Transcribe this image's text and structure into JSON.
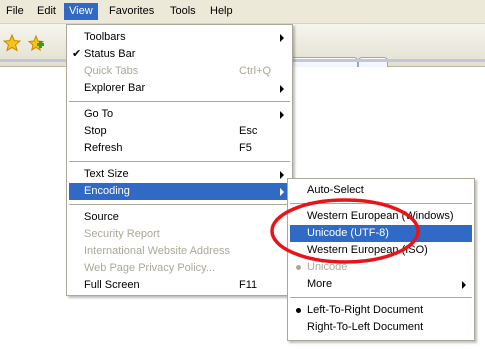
{
  "menubar": {
    "items": [
      {
        "label": "File"
      },
      {
        "label": "Edit"
      },
      {
        "label": "View"
      },
      {
        "label": "Favorites"
      },
      {
        "label": "Tools"
      },
      {
        "label": "Help"
      }
    ]
  },
  "toolbar": {
    "icons": [
      "favorites-star-icon",
      "add-favorite-icon"
    ]
  },
  "view_menu": {
    "items": [
      {
        "label": "Toolbars",
        "submenu": true
      },
      {
        "label": "Status Bar",
        "checked": true
      },
      {
        "label": "Quick Tabs",
        "shortcut": "Ctrl+Q",
        "disabled": true
      },
      {
        "label": "Explorer Bar",
        "submenu": true
      },
      {
        "label": "Go To",
        "submenu": true
      },
      {
        "label": "Stop",
        "shortcut": "Esc"
      },
      {
        "label": "Refresh",
        "shortcut": "F5"
      },
      {
        "label": "Text Size",
        "submenu": true
      },
      {
        "label": "Encoding",
        "submenu": true,
        "highlighted": true
      },
      {
        "label": "Source"
      },
      {
        "label": "Security Report",
        "disabled": true
      },
      {
        "label": "International Website Address",
        "disabled": true
      },
      {
        "label": "Web Page Privacy Policy...",
        "disabled": true
      },
      {
        "label": "Full Screen",
        "shortcut": "F11"
      }
    ]
  },
  "encoding_menu": {
    "items": [
      {
        "label": "Auto-Select"
      },
      {
        "label": "Western European (Windows)"
      },
      {
        "label": "Unicode (UTF-8)",
        "highlighted": true
      },
      {
        "label": "Western European (ISO)"
      },
      {
        "label": "Unicode",
        "disabled": true,
        "bullet": true
      },
      {
        "label": "More",
        "submenu": true
      },
      {
        "label": "Left-To-Right Document",
        "bullet": true
      },
      {
        "label": "Right-To-Left Document"
      }
    ]
  },
  "colors": {
    "highlight": "#316ac5",
    "disabled_text": "#aca899",
    "annotation": "#e8141a"
  }
}
